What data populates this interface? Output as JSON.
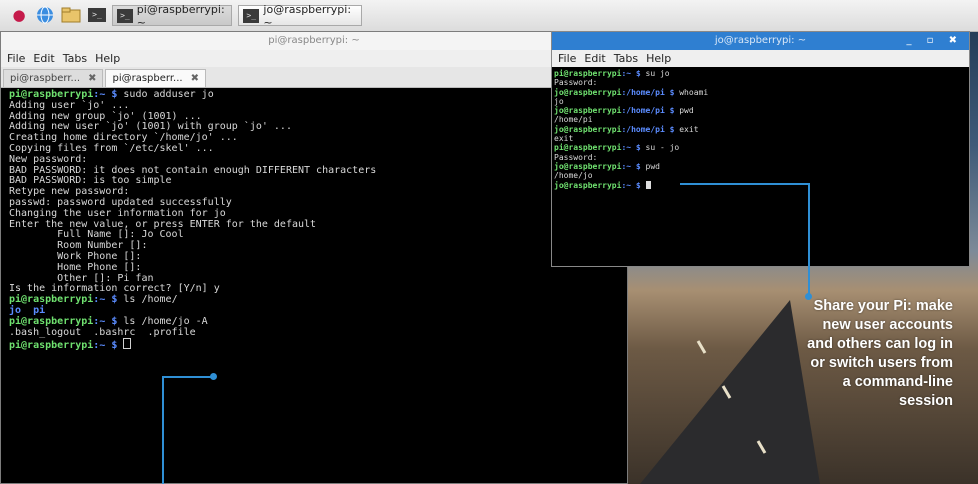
{
  "taskbar": {
    "tasks": [
      {
        "label": "pi@raspberrypi: ~"
      },
      {
        "label": "jo@raspberrypi: ~"
      }
    ]
  },
  "window1": {
    "title": "pi@raspberrypi: ~",
    "menu": [
      "File",
      "Edit",
      "Tabs",
      "Help"
    ],
    "tabs": [
      {
        "label": "pi@raspberr...",
        "close": "✖"
      },
      {
        "label": "pi@raspberr...",
        "close": "✖"
      }
    ],
    "prompt_user": "pi@raspberrypi",
    "prompt_path": ":~ $",
    "cmd1": " sudo adduser jo",
    "output1": [
      "Adding user `jo' ...",
      "Adding new group `jo' (1001) ...",
      "Adding new user `jo' (1001) with group `jo' ...",
      "Creating home directory `/home/jo' ...",
      "Copying files from `/etc/skel' ...",
      "New password:",
      "BAD PASSWORD: it does not contain enough DIFFERENT characters",
      "BAD PASSWORD: is too simple",
      "Retype new password:",
      "passwd: password updated successfully",
      "Changing the user information for jo",
      "Enter the new value, or press ENTER for the default",
      "        Full Name []: Jo Cool",
      "        Room Number []:",
      "        Work Phone []:",
      "        Home Phone []:",
      "        Other []: Pi fan",
      "Is the information correct? [Y/n] y"
    ],
    "cmd2": " ls /home/",
    "output2_jo": "jo",
    "output2_pi": "  pi",
    "cmd3": " ls /home/jo -A",
    "output3": ".bash_logout  .bashrc  .profile"
  },
  "window2": {
    "title": "jo@raspberrypi: ~",
    "controls": "_ ▫ ✖",
    "menu": [
      "File",
      "Edit",
      "Tabs",
      "Help"
    ],
    "lines": [
      {
        "user": "pi@raspberrypi",
        "path": ":~ $",
        "cmd": " su jo"
      },
      {
        "text": "Password:"
      },
      {
        "user": "jo@raspberrypi",
        "path": ":/home/pi $",
        "cmd": " whoami"
      },
      {
        "text": "jo"
      },
      {
        "user": "jo@raspberrypi",
        "path": ":/home/pi $",
        "cmd": " pwd"
      },
      {
        "text": "/home/pi"
      },
      {
        "user": "jo@raspberrypi",
        "path": ":/home/pi $",
        "cmd": " exit"
      },
      {
        "text": "exit"
      },
      {
        "user": "pi@raspberrypi",
        "path": ":~ $",
        "cmd": " su - jo"
      },
      {
        "text": "Password:"
      },
      {
        "user": "jo@raspberrypi",
        "path": ":~ $",
        "cmd": " pwd"
      },
      {
        "text": "/home/jo"
      }
    ],
    "last_user": "jo@raspberrypi",
    "last_path": ":~ $"
  },
  "caption": "Share your Pi: make new user accounts and others can log in or switch users from a command-line session",
  "colors": {
    "accent": "#2f8fd5",
    "prompt_user": "#6fe06f",
    "prompt_path": "#5b8cff"
  }
}
